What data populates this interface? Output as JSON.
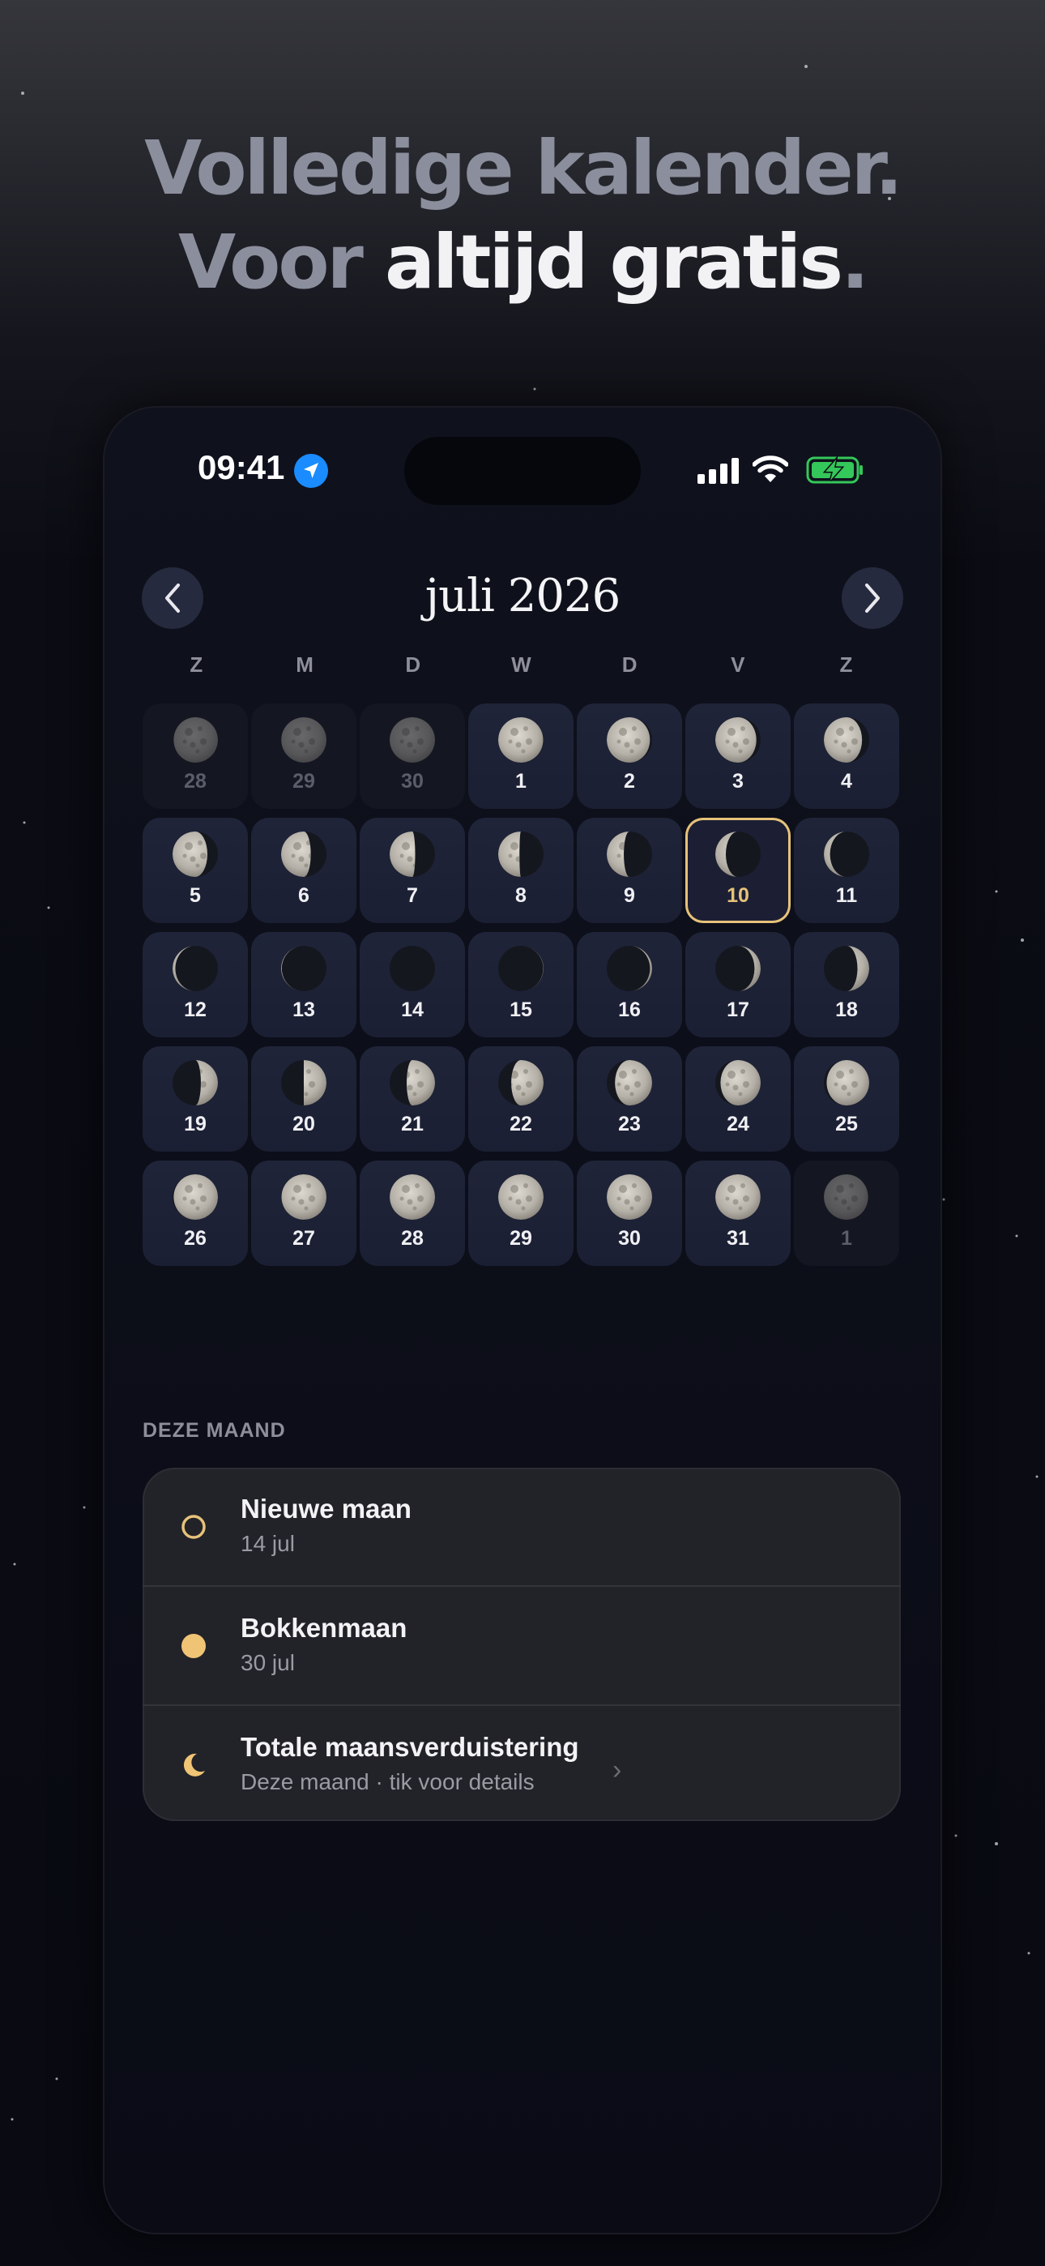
{
  "headline": {
    "line1": "Volledige kalender.",
    "line2_dim": "Voor ",
    "line2_bright": "altijd gratis",
    "line2_end": "."
  },
  "status_bar": {
    "time": "09:41",
    "icons": [
      "location-arrow-icon",
      "cellular-signal-icon",
      "wifi-icon",
      "battery-charging-icon"
    ]
  },
  "calendar": {
    "month_title": "juli 2026",
    "prev_icon": "chevron-left-icon",
    "next_icon": "chevron-right-icon",
    "weekdays": [
      "Z",
      "M",
      "D",
      "W",
      "D",
      "V",
      "Z"
    ],
    "days": [
      {
        "n": "28",
        "phase": 0.45,
        "other": true
      },
      {
        "n": "29",
        "phase": 0.48,
        "other": true
      },
      {
        "n": "30",
        "phase": 0.5,
        "other": true
      },
      {
        "n": "1",
        "phase": 0.53
      },
      {
        "n": "2",
        "phase": 0.57
      },
      {
        "n": "3",
        "phase": 0.6
      },
      {
        "n": "4",
        "phase": 0.63
      },
      {
        "n": "5",
        "phase": 0.66
      },
      {
        "n": "6",
        "phase": 0.7
      },
      {
        "n": "7",
        "phase": 0.73
      },
      {
        "n": "8",
        "phase": 0.76
      },
      {
        "n": "9",
        "phase": 0.79
      },
      {
        "n": "10",
        "phase": 0.84,
        "today": true
      },
      {
        "n": "11",
        "phase": 0.88
      },
      {
        "n": "12",
        "phase": 0.92
      },
      {
        "n": "13",
        "phase": 0.96
      },
      {
        "n": "14",
        "phase": 0.0
      },
      {
        "n": "15",
        "phase": 0.03
      },
      {
        "n": "16",
        "phase": 0.07
      },
      {
        "n": "17",
        "phase": 0.12
      },
      {
        "n": "18",
        "phase": 0.17
      },
      {
        "n": "19",
        "phase": 0.21
      },
      {
        "n": "20",
        "phase": 0.25
      },
      {
        "n": "21",
        "phase": 0.29
      },
      {
        "n": "22",
        "phase": 0.32
      },
      {
        "n": "23",
        "phase": 0.36
      },
      {
        "n": "24",
        "phase": 0.39
      },
      {
        "n": "25",
        "phase": 0.42
      },
      {
        "n": "26",
        "phase": 0.45
      },
      {
        "n": "27",
        "phase": 0.47
      },
      {
        "n": "28",
        "phase": 0.49
      },
      {
        "n": "29",
        "phase": 0.5
      },
      {
        "n": "30",
        "phase": 0.5
      },
      {
        "n": "31",
        "phase": 0.52
      },
      {
        "n": "1",
        "phase": 0.55,
        "other": true
      }
    ]
  },
  "this_month": {
    "title": "DEZE MAAND",
    "events": [
      {
        "icon": "new-moon-ring-icon",
        "title": "Nieuwe maan",
        "subtitle": "14 jul",
        "chevron": false
      },
      {
        "icon": "full-moon-dot-icon",
        "title": "Bokkenmaan",
        "subtitle": "30 jul",
        "chevron": false
      },
      {
        "icon": "crescent-moon-icon",
        "title": "Totale maansverduistering",
        "subtitle": "Deze maand · tik voor details",
        "chevron": true,
        "chevron_glyph": "›"
      }
    ]
  },
  "colors": {
    "accent_gold": "#e6c27a",
    "cell_bg": "#1f2439",
    "card_bg": "#222328",
    "battery_green": "#34c759",
    "location_blue": "#1a8cff"
  }
}
